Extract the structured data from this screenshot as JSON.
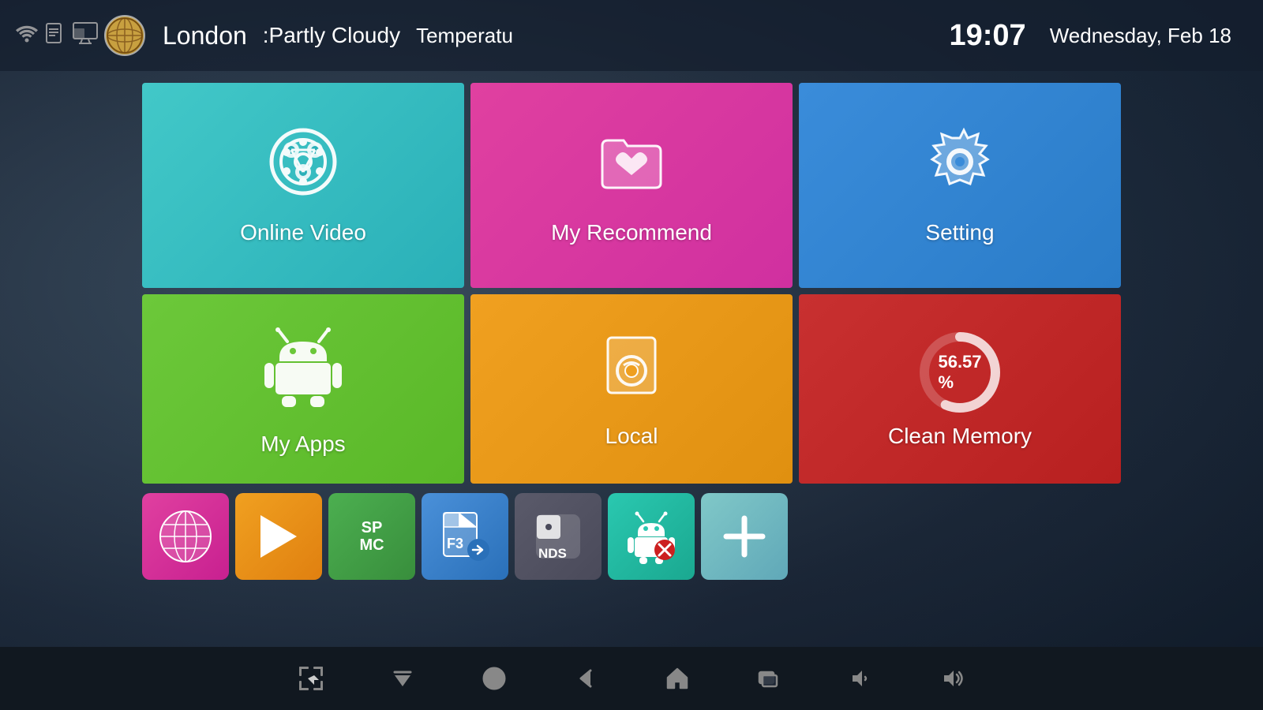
{
  "statusBar": {
    "city": "London",
    "weatherDesc": ":Partly Cloudy",
    "tempLabel": "Temperatu",
    "time": "19:07",
    "date": "Wednesday, Feb 18"
  },
  "tiles": [
    {
      "id": "online-video",
      "label": "Online Video"
    },
    {
      "id": "my-recommend",
      "label": "My Recommend"
    },
    {
      "id": "setting",
      "label": "Setting"
    },
    {
      "id": "my-apps",
      "label": "My Apps"
    },
    {
      "id": "local",
      "label": "Local"
    },
    {
      "id": "clean-memory",
      "label": "Clean Memory",
      "percent": "56.57 %"
    }
  ],
  "bottomApps": [
    {
      "id": "browser",
      "label": "Browser"
    },
    {
      "id": "play",
      "label": "Play Store"
    },
    {
      "id": "spmc",
      "label": "SPMC"
    },
    {
      "id": "es",
      "label": "ES File Explorer"
    },
    {
      "id": "nds",
      "label": "NDS"
    },
    {
      "id": "android-x",
      "label": "Android X"
    },
    {
      "id": "add",
      "label": "Add"
    }
  ],
  "navBar": {
    "buttons": [
      "screenshot",
      "menu",
      "power",
      "back",
      "home",
      "recent",
      "volume-down",
      "volume-up"
    ]
  },
  "memoryPercent": "56.57 %",
  "colors": {
    "onlineVideo": "#42c8c8",
    "myRecommend": "#e040a0",
    "setting": "#3a8cda",
    "myApps": "#6cc83a",
    "local": "#f0a020",
    "cleanMemory": "#c83030"
  }
}
